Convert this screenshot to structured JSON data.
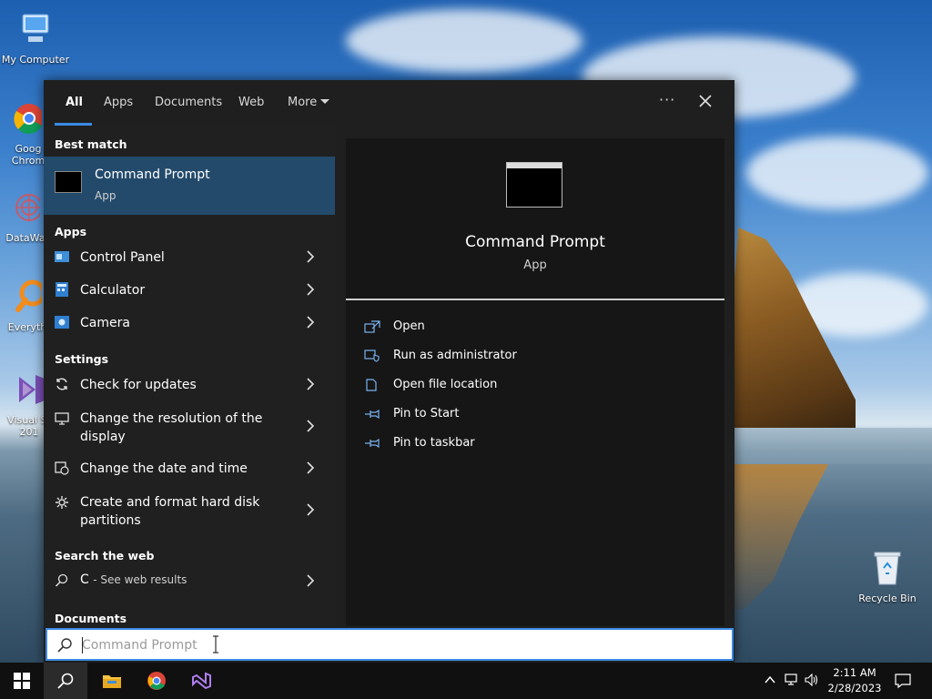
{
  "desktop": {
    "icons": [
      {
        "label": "My Computer"
      },
      {
        "label": "Goog Chrom"
      },
      {
        "label": "DataWa"
      },
      {
        "label": "Everyth"
      },
      {
        "label": "Visual St 201"
      },
      {
        "label": "Recycle Bin"
      }
    ]
  },
  "tabs": [
    {
      "label": "All"
    },
    {
      "label": "Apps"
    },
    {
      "label": "Documents"
    },
    {
      "label": "Web"
    },
    {
      "label": "More"
    }
  ],
  "tab_more_dots": "···",
  "sections": {
    "best_match": "Best match",
    "apps": "Apps",
    "settings": "Settings",
    "search_web": "Search the web",
    "documents": "Documents"
  },
  "best_match": {
    "name": "Command Prompt",
    "type": "App"
  },
  "apps": [
    {
      "label": "Control Panel"
    },
    {
      "label": "Calculator"
    },
    {
      "label": "Camera"
    }
  ],
  "settings": [
    {
      "label": "Check for updates"
    },
    {
      "label": "Change the resolution of the display"
    },
    {
      "label": "Change the date and time"
    },
    {
      "label": "Create and format hard disk partitions"
    }
  ],
  "web_result": {
    "query": "C",
    "suffix": "- See web results"
  },
  "preview": {
    "name": "Command Prompt",
    "type": "App",
    "actions": [
      {
        "label": "Open"
      },
      {
        "label": "Run as administrator"
      },
      {
        "label": "Open file location"
      },
      {
        "label": "Pin to Start"
      },
      {
        "label": "Pin to taskbar"
      }
    ]
  },
  "search": {
    "value": "C",
    "placeholder": "Command Prompt"
  },
  "clock": {
    "time": "2:11 AM",
    "date": "2/28/2023"
  },
  "colors": {
    "accent": "#3a8be6",
    "selected": "#234a6b",
    "panel": "#1f1f1f"
  }
}
